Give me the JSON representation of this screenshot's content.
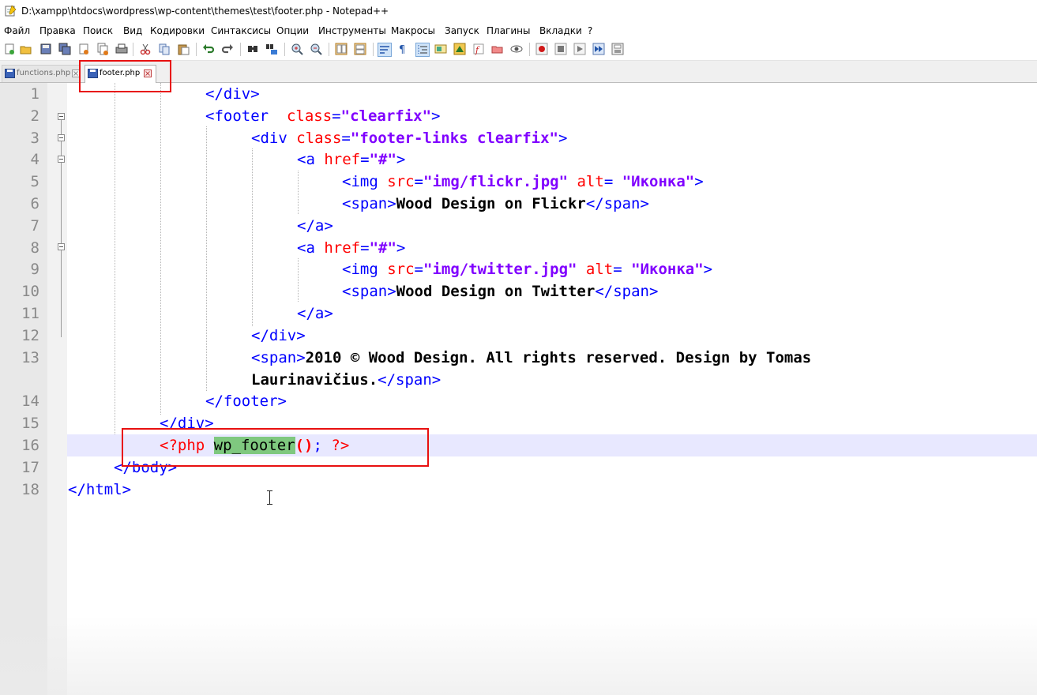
{
  "window": {
    "title": "D:\\xampp\\htdocs\\wordpress\\wp-content\\themes\\test\\footer.php - Notepad++",
    "app_icon": "notepad-icon"
  },
  "menu": [
    "Файл",
    "Правка",
    "Поиск",
    "Вид",
    "Кодировки",
    "Синтаксисы",
    "Опции",
    "Инструменты",
    "Макросы",
    "Запуск",
    "Плагины",
    "Вкладки",
    "?"
  ],
  "toolbar_icons": [
    "new-file-icon",
    "open-file-icon",
    "save-icon",
    "save-all-icon",
    "close-icon",
    "close-all-icon",
    "print-icon",
    "cut-icon",
    "copy-icon",
    "paste-icon",
    "undo-icon",
    "redo-icon",
    "find-icon",
    "replace-icon",
    "zoom-in-icon",
    "zoom-out-icon",
    "sync-vertical-icon",
    "sync-horizontal-icon",
    "word-wrap-icon",
    "show-all-chars-icon",
    "indent-guide-icon",
    "define-language-icon",
    "doc-map-icon",
    "function-list-icon",
    "folder-workspace-icon",
    "monitoring-icon",
    "record-macro-icon",
    "stop-record-icon",
    "play-macro-icon",
    "run-macro-multiple-icon",
    "save-macro-icon"
  ],
  "tabs": [
    {
      "label": "functions.php",
      "icon": "saved-file-icon",
      "active": false
    },
    {
      "label": "footer.php",
      "icon": "saved-file-icon",
      "active": true
    }
  ],
  "editor": {
    "current_line": 16,
    "lines": [
      {
        "n": "1"
      },
      {
        "n": "2"
      },
      {
        "n": "3"
      },
      {
        "n": "4"
      },
      {
        "n": "5"
      },
      {
        "n": "6"
      },
      {
        "n": "7"
      },
      {
        "n": "8"
      },
      {
        "n": "9"
      },
      {
        "n": "10"
      },
      {
        "n": "11"
      },
      {
        "n": "12"
      },
      {
        "n": "13"
      },
      {
        "n": "14"
      },
      {
        "n": "15"
      },
      {
        "n": "16"
      },
      {
        "n": "17"
      },
      {
        "n": "18"
      }
    ],
    "tokens": {
      "l1_close_div": "</div>",
      "l2_open": "<footer",
      "l2_attr": "class",
      "l2_eq": "=",
      "l2_val": "\"clearfix\"",
      "l2_close": ">",
      "l3_open": "<div",
      "l3_attr": "class",
      "l3_eq": "=",
      "l3_val": "\"footer-links clearfix\"",
      "l3_close": ">",
      "l4_open": "<a",
      "l4_attr": "href",
      "l4_eq": "=",
      "l4_val": "\"#\"",
      "l4_close": ">",
      "l5_open": "<img",
      "l5_attr1": "src",
      "l5_eq1": "=",
      "l5_val1": "\"img/flickr.jpg\"",
      "l5_attr2": "alt",
      "l5_eq2": "=",
      "l5_val2": "\"Иконка\"",
      "l5_close": ">",
      "l6_open": "<span>",
      "l6_text": "Wood Design on Flickr",
      "l6_close": "</span>",
      "l7_close_a": "</a>",
      "l8_open": "<a",
      "l8_attr": "href",
      "l8_eq": "=",
      "l8_val": "\"#\"",
      "l8_close": ">",
      "l9_open": "<img",
      "l9_attr1": "src",
      "l9_eq1": "=",
      "l9_val1": "\"img/twitter.jpg\"",
      "l9_attr2": "alt",
      "l9_eq2": "=",
      "l9_val2": "\"Иконка\"",
      "l9_close": ">",
      "l10_open": "<span>",
      "l10_text": "Wood Design on Twitter",
      "l10_close": "</span>",
      "l11_close_a": "</a>",
      "l12_close_div": "</div>",
      "l13_open": "<span>",
      "l13_text_a": "2010 © Wood Design. All rights reserved. Design by Tomas",
      "l13_text_b": "Laurinavičius.",
      "l13_close": "</span>",
      "l14_close_footer": "</footer>",
      "l15_close_div": "</div>",
      "l16_php_open": "<?php",
      "l16_fn": "wp_footer",
      "l16_paren": "()",
      "l16_semi": ";",
      "l16_php_close": "?>",
      "l17_close_body": "</body>",
      "l18_close_html": "</html>"
    }
  },
  "annotations": {
    "highlight_color": "#e81010"
  }
}
